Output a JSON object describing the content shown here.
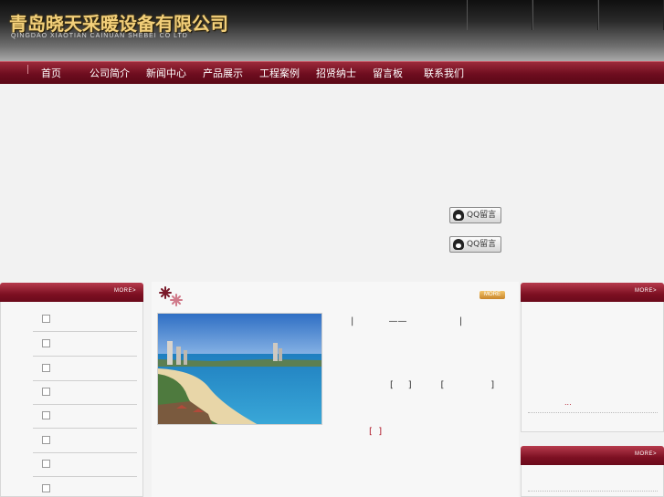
{
  "header": {
    "company_cn": "青岛晓天采暖设备有限公司",
    "company_en": "QINGDAO  XIAOTIAN  CAINUAN  SHEBEI  CO  LTD"
  },
  "nav": {
    "items": [
      "首页",
      "公司简介",
      "新闻中心",
      "产品展示",
      "工程案例",
      "招贤纳士",
      "留言板",
      "联系我们"
    ]
  },
  "qq": {
    "button1": "QQ留言",
    "button2": "QQ留言"
  },
  "left_panel": {
    "more": "MORE>"
  },
  "center": {
    "more": "MORE",
    "intro_line1": "|            ——                  |",
    "intro_line2": "[     ]          [                ]",
    "intro_line3": "[  ]"
  },
  "right_panel": {
    "more": "MORE>",
    "ellipsis": "...",
    "more2": "MORE>"
  }
}
